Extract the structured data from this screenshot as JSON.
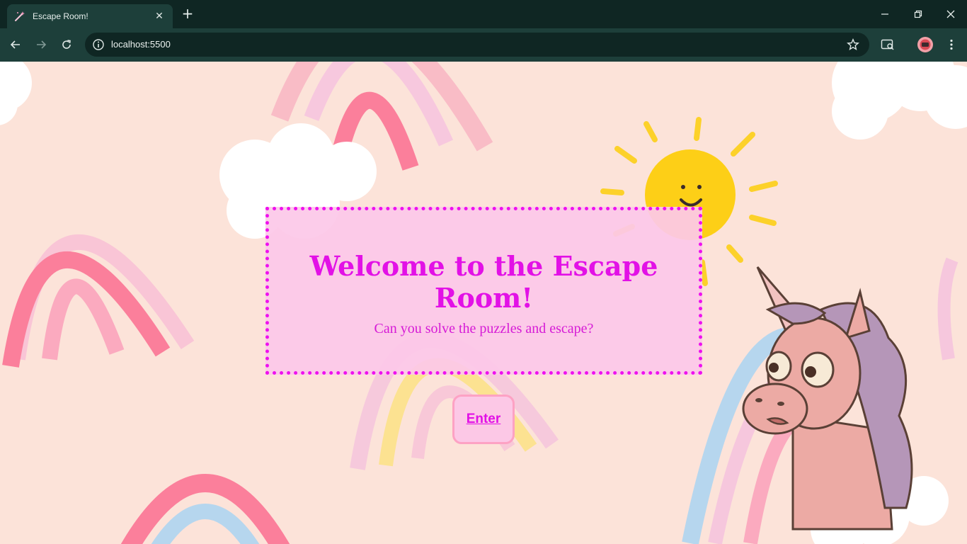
{
  "browser": {
    "tab_title": "Escape Room!",
    "tab_icon": "magic-wand-icon",
    "url": "localhost:5500"
  },
  "page": {
    "title": "Welcome to the Escape Room!",
    "subtitle": "Can you solve the puzzles and escape?",
    "enter_label": "Enter"
  },
  "colors": {
    "background": "#fce3d9",
    "accent": "#e211e6",
    "box_fill": "#fcc8e6",
    "button_border": "#fda2c4"
  }
}
